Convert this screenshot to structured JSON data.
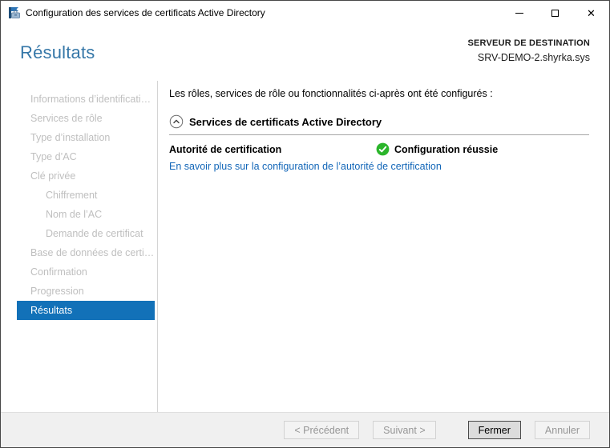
{
  "window": {
    "title": "Configuration des services de certificats Active Directory"
  },
  "header": {
    "page_title": "Résultats",
    "destination_label": "SERVEUR DE DESTINATION",
    "destination_server": "SRV-DEMO-2.shyrka.sys"
  },
  "sidebar": {
    "items": [
      {
        "label": "Informations d’identificati…",
        "level": 1,
        "state": "disabled"
      },
      {
        "label": "Services de rôle",
        "level": 1,
        "state": "disabled"
      },
      {
        "label": "Type d’installation",
        "level": 1,
        "state": "disabled"
      },
      {
        "label": "Type d’AC",
        "level": 1,
        "state": "disabled"
      },
      {
        "label": "Clé privée",
        "level": 1,
        "state": "disabled"
      },
      {
        "label": "Chiffrement",
        "level": 2,
        "state": "disabled"
      },
      {
        "label": "Nom de l’AC",
        "level": 2,
        "state": "disabled"
      },
      {
        "label": "Demande de certificat",
        "level": 2,
        "state": "disabled"
      },
      {
        "label": "Base de données de certi…",
        "level": 1,
        "state": "disabled"
      },
      {
        "label": "Confirmation",
        "level": 1,
        "state": "disabled"
      },
      {
        "label": "Progression",
        "level": 1,
        "state": "disabled"
      },
      {
        "label": "Résultats",
        "level": 1,
        "state": "selected"
      }
    ]
  },
  "main": {
    "intro": "Les rôles, services de rôle ou fonctionnalités ci-après ont été configurés :",
    "section_title": "Services de certificats Active Directory",
    "result": {
      "name": "Autorité de certification",
      "status": "Configuration réussie"
    },
    "link": "En savoir plus sur la configuration de l’autorité de certification"
  },
  "footer": {
    "buttons": [
      {
        "label": "< Précédent",
        "state": "disabled"
      },
      {
        "label": "Suivant >",
        "state": "disabled"
      },
      {
        "label": "Fermer",
        "state": "default"
      },
      {
        "label": "Annuler",
        "state": "disabled"
      }
    ]
  },
  "colors": {
    "selection_blue": "#1271b8",
    "title_blue": "#3577a8",
    "link_blue": "#1266b8",
    "success_green": "#2bb52b",
    "footer_gray": "#f0f0f0",
    "disabled_text": "#bfbfbf"
  }
}
